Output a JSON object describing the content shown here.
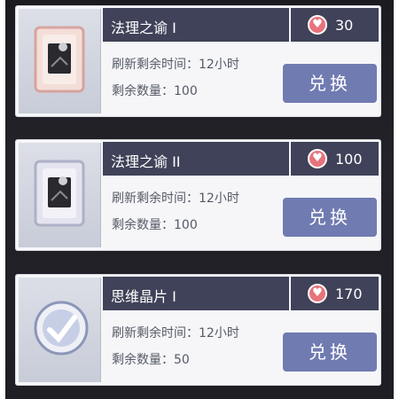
{
  "items": [
    {
      "name": "法理之谕 I",
      "price": "30",
      "refresh_label": "刷新剩余时间：",
      "refresh_value": "12小时",
      "qty_label": "剩余数量：",
      "qty_value": "100",
      "button": "兑换",
      "icon": "tome-icon"
    },
    {
      "name": "法理之谕 II",
      "price": "100",
      "refresh_label": "刷新剩余时间：",
      "refresh_value": "12小时",
      "qty_label": "剩余数量：",
      "qty_value": "100",
      "button": "兑换",
      "icon": "tome-icon"
    },
    {
      "name": "思维晶片 I",
      "price": "170",
      "refresh_label": "刷新剩余时间：",
      "refresh_value": "12小时",
      "qty_label": "剩余数量：",
      "qty_value": "50",
      "button": "兑换",
      "icon": "chip-icon"
    }
  ],
  "colors": {
    "background": "#1e1e24",
    "titlebar": "#3f4258",
    "button": "#707bb1",
    "heart": "#e7737c"
  }
}
